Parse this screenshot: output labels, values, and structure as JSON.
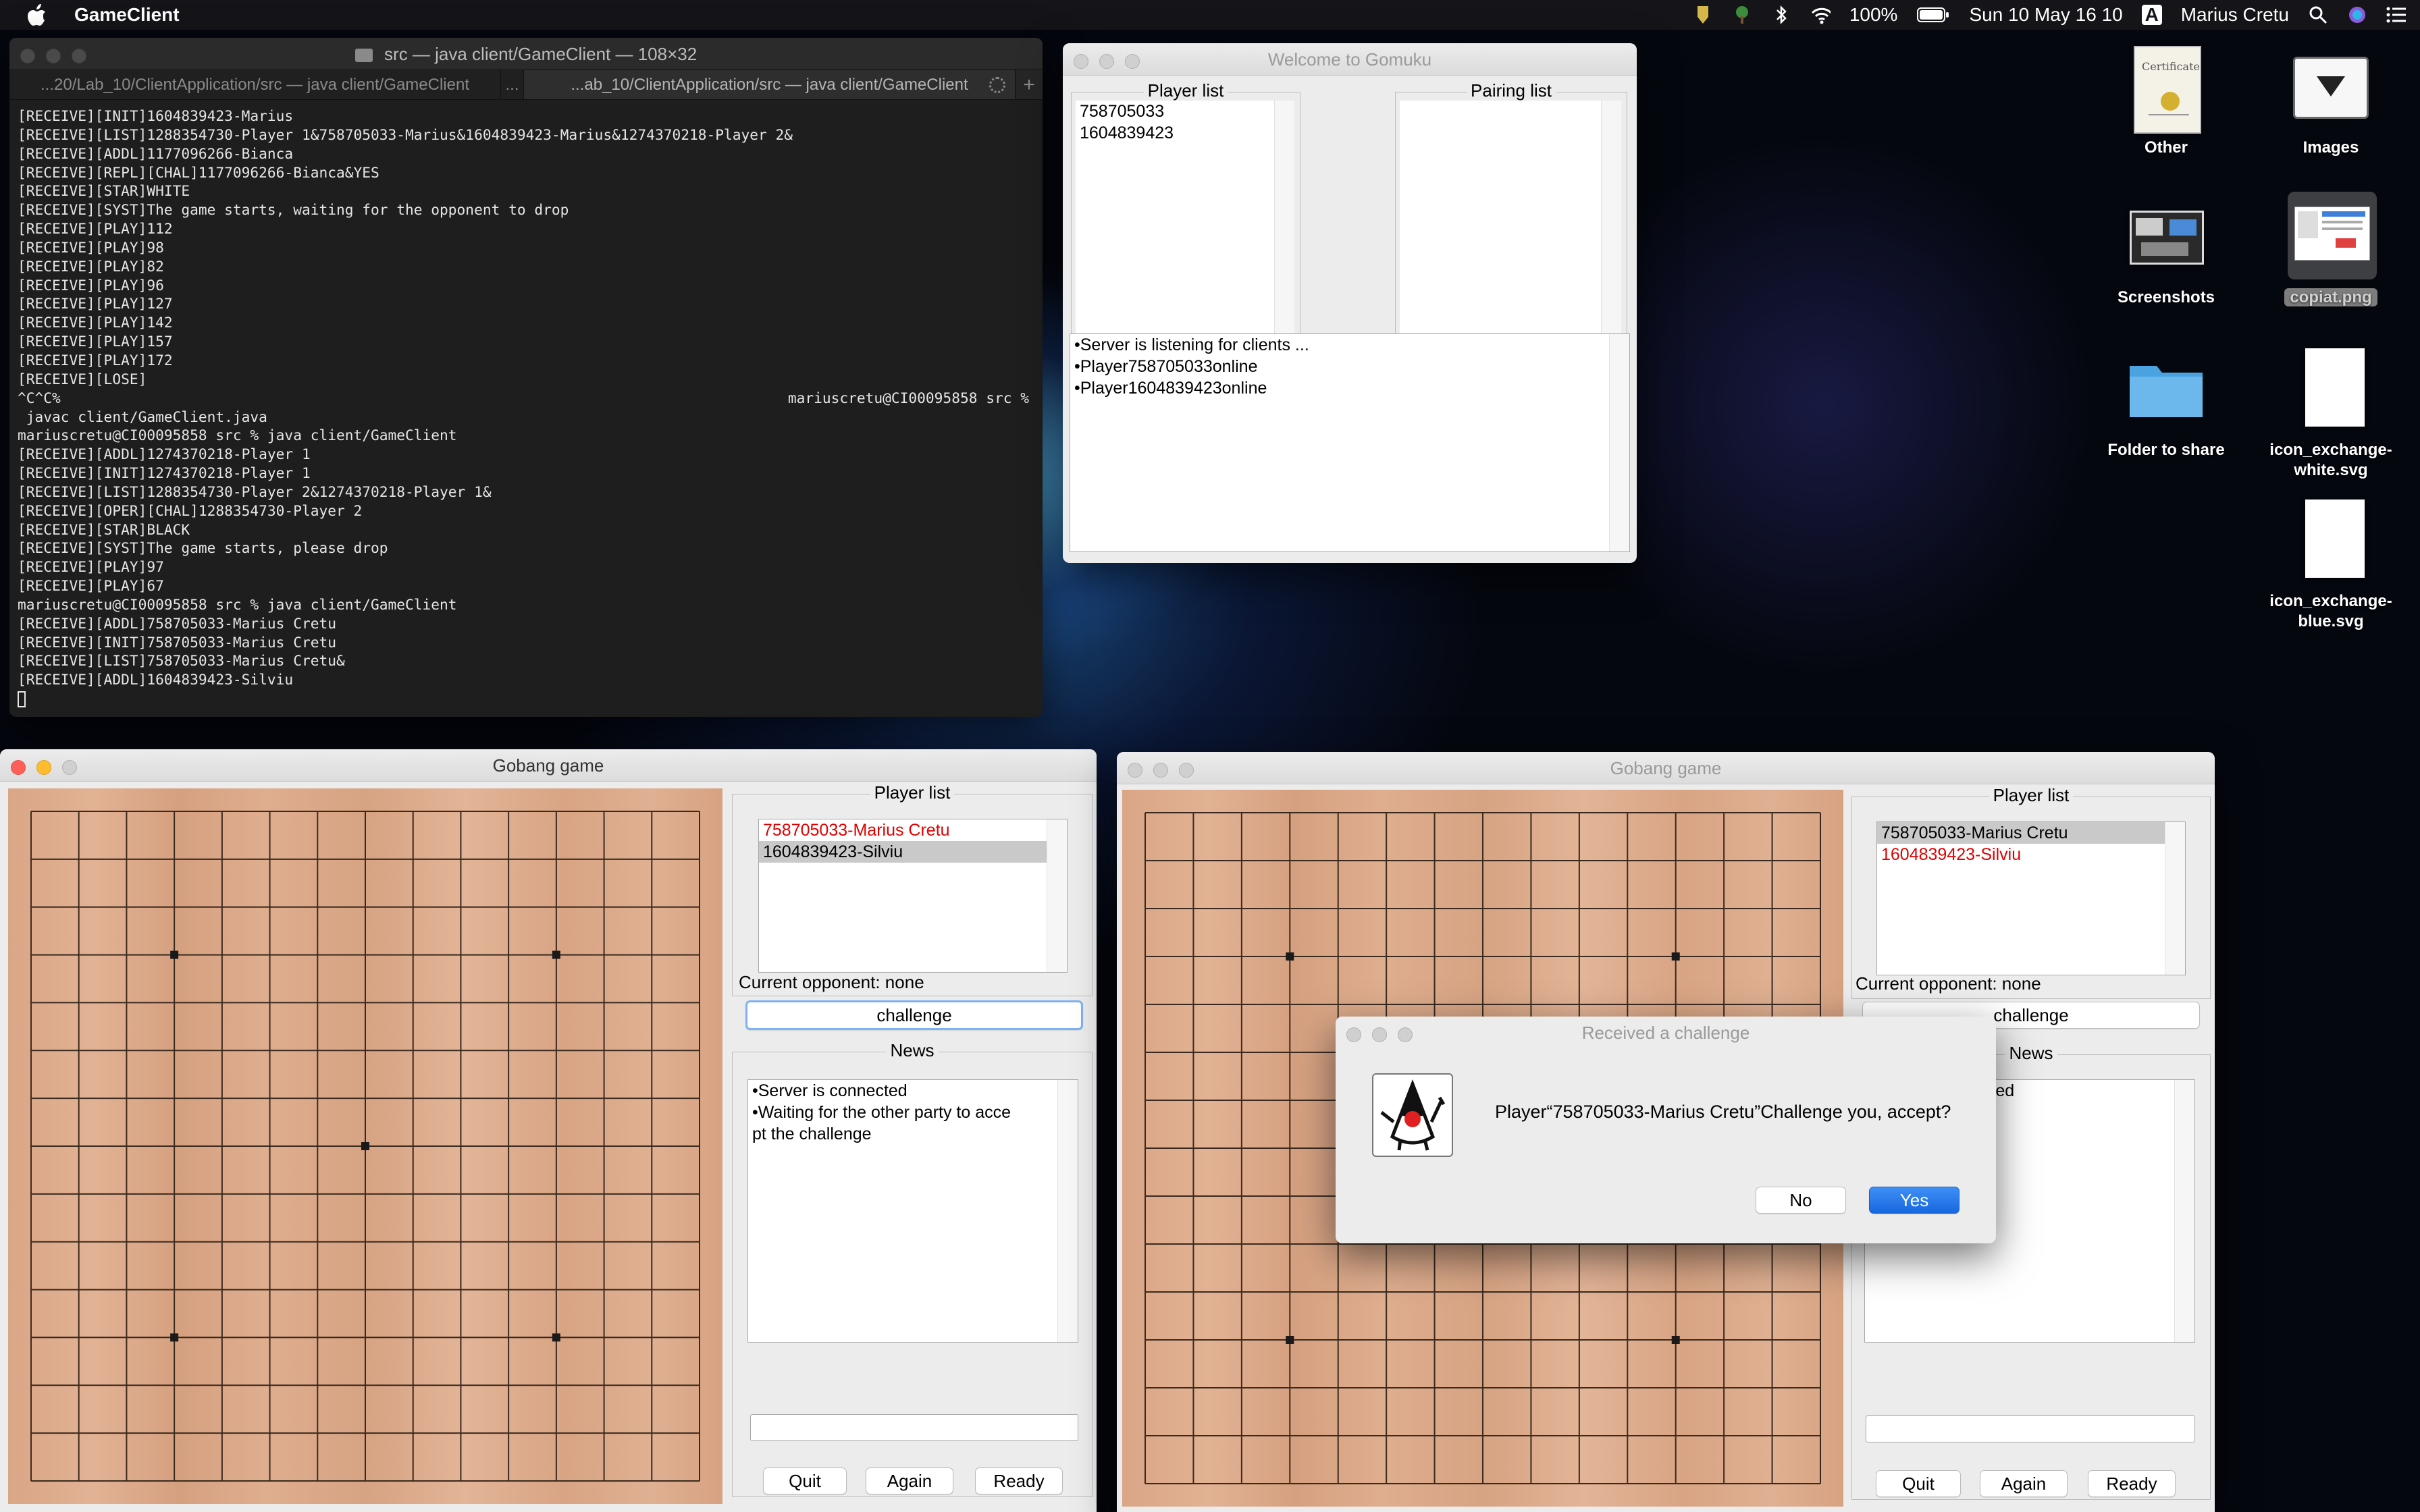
{
  "menubar": {
    "app_name": "GameClient",
    "battery": "100%",
    "datetime": "Sun 10 May  16 10",
    "input_source": "A",
    "user": "Marius Cretu"
  },
  "terminal": {
    "title": "src — java client/GameClient — 108×32",
    "tabs": [
      "...20/Lab_10/ClientApplication/src — java client/GameClient",
      "...ab_10/ClientApplication/src — java client/GameClient"
    ],
    "tab_overflow": "...",
    "new_tab": "+",
    "lines": [
      "[RECEIVE][INIT]1604839423-Marius",
      "[RECEIVE][LIST]1288354730-Player 1&758705033-Marius&1604839423-Marius&1274370218-Player 2&",
      "[RECEIVE][ADDL]1177096266-Bianca",
      "[RECEIVE][REPL][CHAL]1177096266-Bianca&YES",
      "[RECEIVE][STAR]WHITE",
      "[RECEIVE][SYST]The game starts, waiting for the opponent to drop",
      "[RECEIVE][PLAY]112",
      "[RECEIVE][PLAY]98",
      "[RECEIVE][PLAY]82",
      "[RECEIVE][PLAY]96",
      "[RECEIVE][PLAY]127",
      "[RECEIVE][PLAY]142",
      "[RECEIVE][PLAY]157",
      "[RECEIVE][PLAY]172",
      "[RECEIVE][LOSE]",
      "^C^C%",
      " javac client/GameClient.java",
      "mariuscretu@CI00095858 src % java client/GameClient",
      "[RECEIVE][ADDL]1274370218-Player 1",
      "[RECEIVE][INIT]1274370218-Player 1",
      "[RECEIVE][LIST]1288354730-Player 2&1274370218-Player 1&",
      "[RECEIVE][OPER][CHAL]1288354730-Player 2",
      "[RECEIVE][STAR]BLACK",
      "[RECEIVE][SYST]The game starts, please drop",
      "[RECEIVE][PLAY]97",
      "[RECEIVE][PLAY]67",
      "mariuscretu@CI00095858 src % java client/GameClient",
      "[RECEIVE][ADDL]758705033-Marius Cretu",
      "[RECEIVE][INIT]758705033-Marius Cretu",
      "[RECEIVE][LIST]758705033-Marius Cretu&",
      "[RECEIVE][ADDL]1604839423-Silviu"
    ],
    "prompt_right": "mariuscretu@CI00095858 src %"
  },
  "server": {
    "title": "Welcome to Gomuku",
    "player_list_label": "Player list",
    "pairing_list_label": "Pairing list",
    "players": [
      "758705033",
      "1604839423"
    ],
    "log": [
      "•Server is listening for clients  ...",
      "•Player758705033online",
      "•Player1604839423online"
    ]
  },
  "game_left": {
    "title": "Gobang game",
    "player_list_label": "Player list",
    "players": [
      "758705033-Marius Cretu",
      "1604839423-Silviu"
    ],
    "opponent": "Current opponent: none",
    "challenge": "challenge",
    "news_label": "News",
    "news": [
      "•Server is connected",
      "•Waiting for the other party to acce",
      "pt the challenge"
    ],
    "quit": "Quit",
    "again": "Again",
    "ready": "Ready"
  },
  "game_right": {
    "title": "Gobang game",
    "player_list_label": "Player list",
    "players": [
      "758705033-Marius Cretu",
      "1604839423-Silviu"
    ],
    "opponent": "Current opponent: none",
    "challenge": "challenge",
    "news_label": "News",
    "news_visible": "ected",
    "quit": "Quit",
    "again": "Again",
    "ready": "Ready"
  },
  "dialog": {
    "title": "Received a challenge",
    "message": "Player“758705033-Marius Cretu”Challenge you, accept?",
    "no": "No",
    "yes": "Yes",
    "icon": "java-duke-icon"
  },
  "desktop": {
    "icons": [
      {
        "label": "Other",
        "icon": "folder-thumbnail-icon"
      },
      {
        "label": "Images",
        "icon": "downloads-folder-icon"
      },
      {
        "label": "Screenshots",
        "icon": "screenshots-folder-icon"
      },
      {
        "label": "copiat.png",
        "icon": "image-file-icon"
      },
      {
        "label": "Folder to share",
        "icon": "blue-folder-icon"
      },
      {
        "label": "icon_exchange-\nwhite.svg",
        "icon": "svg-file-icon"
      },
      {
        "label": "icon_exchange-\nblue.svg",
        "icon": "svg-file-icon"
      }
    ]
  },
  "colors": {
    "red_player": "#e00000",
    "accent": "#1767df"
  }
}
